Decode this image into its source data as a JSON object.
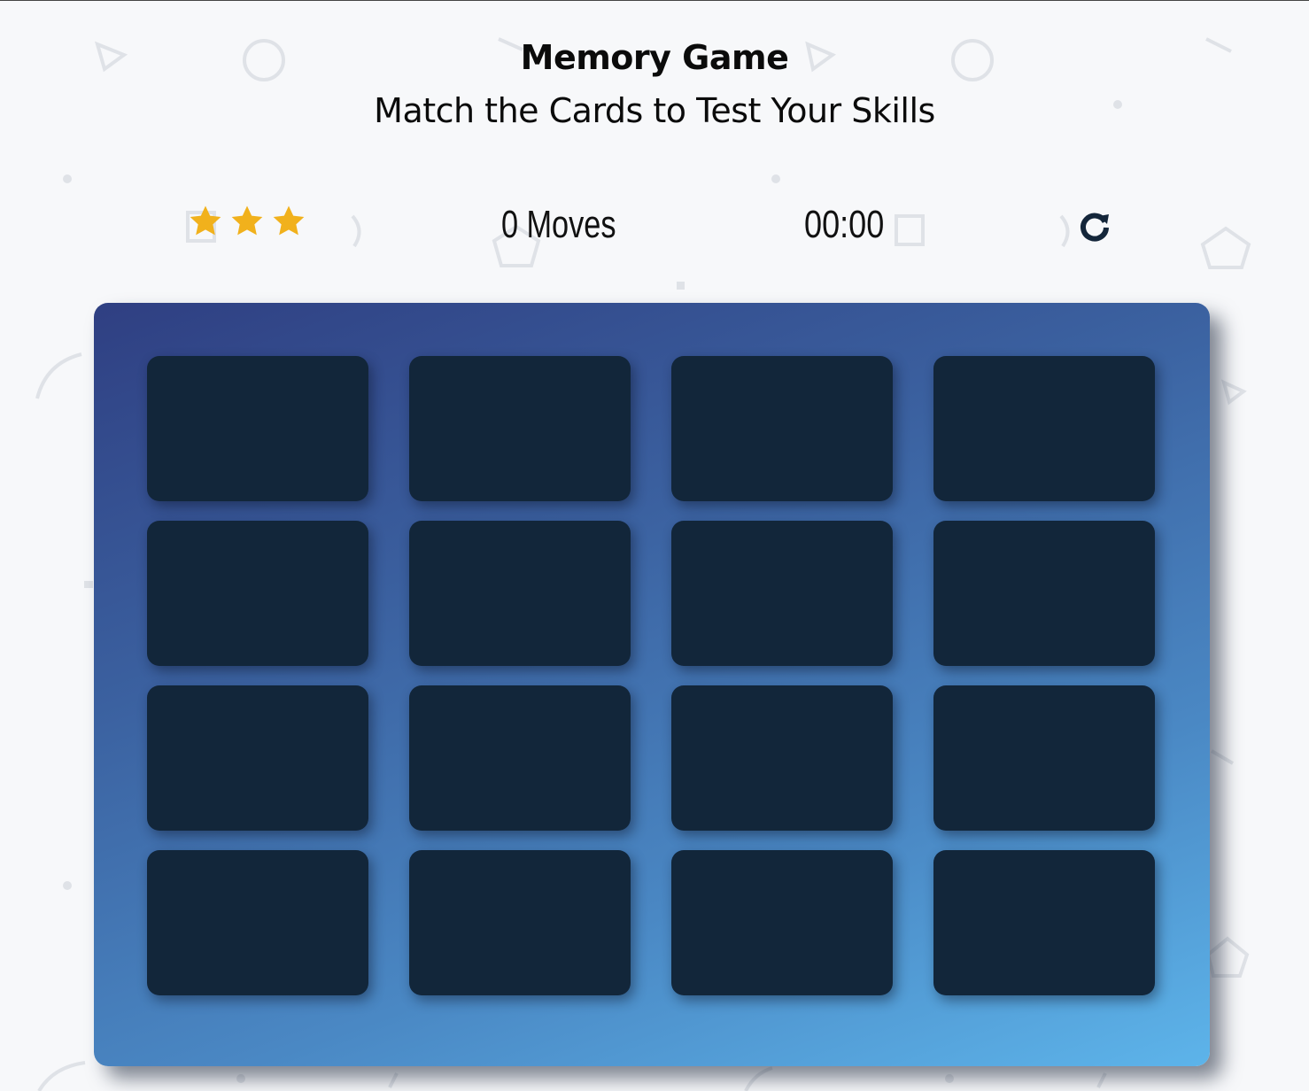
{
  "header": {
    "title": "Memory Game",
    "subtitle": "Match the Cards to Test Your Skills"
  },
  "score_panel": {
    "stars": {
      "count": 3,
      "icon": "star-icon",
      "color": "#f1b11c"
    },
    "moves": {
      "value": "0",
      "label": "Moves"
    },
    "timer": "00:00",
    "restart_icon": "restart-icon"
  },
  "deck": {
    "rows": 4,
    "columns": 4,
    "cards_face_down": 16,
    "gradient_colors": [
      "#2f3f82",
      "#5db4ea"
    ],
    "card_color": "#12263a"
  },
  "colors": {
    "background": "#f7f8fa",
    "text": "#0b0b0b",
    "accent_star": "#f1b11c"
  }
}
